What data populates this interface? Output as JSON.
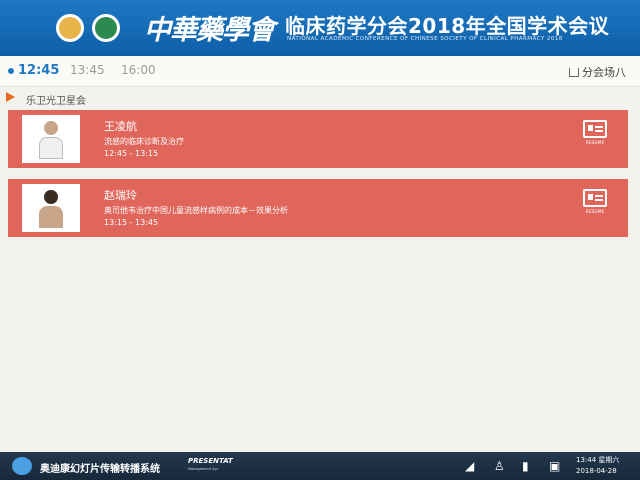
{
  "header": {
    "calligraphy": "中華藥學會",
    "title": "临床药学分会2018年全国学术会议",
    "subtitle": "NATIONAL ACADEMIC CONFERENCE OF CHINESE SOCIETY OF CLINICAL PHARMACY 2018"
  },
  "timebar": {
    "slots": [
      "12:45",
      "13:45",
      "16:00"
    ],
    "active_index": 0,
    "venue": "分会场八"
  },
  "section": {
    "label": "乐卫光卫星会"
  },
  "talks": [
    {
      "speaker": "王凌航",
      "topic": "流感的临床诊断及治疗",
      "time": "12:45 - 13:15",
      "resume_label": "RESUME"
    },
    {
      "speaker": "赵瑞玲",
      "topic": "奥司他韦治疗中国儿童流感样病例的成本－效果分析",
      "time": "13:15 - 13:45",
      "resume_label": "RESUME"
    }
  ],
  "taskbar": {
    "app_name": "奥迪康幻灯片传输转播系统",
    "brand": "PRESENTAT",
    "brand_sub": "Management Sys",
    "time": "13:44 星期六",
    "date": "2018-04-28"
  }
}
